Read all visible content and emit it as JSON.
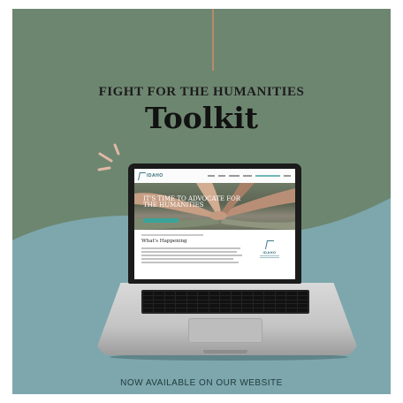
{
  "colors": {
    "sage_background": "#6d8670",
    "teal_background": "#7da7ad",
    "accent_line": "#b78a6c",
    "spark_color": "#e0b8a6"
  },
  "headline": {
    "kicker": "FIGHT FOR THE HUMANITIES",
    "title": "Toolkit"
  },
  "website": {
    "logo_text": "IDAHO",
    "hero_text": "IT'S TIME TO ADVOCATE FOR THE HUMANITIES",
    "section_title": "What's Happening",
    "content_logo_text": "IDAHO"
  },
  "icons": [
    "sparkle-lines-icon",
    "laptop-icon",
    "logo-mark-icon"
  ],
  "footer": {
    "cta": "NOW AVAILABLE ON OUR WEBSITE"
  }
}
